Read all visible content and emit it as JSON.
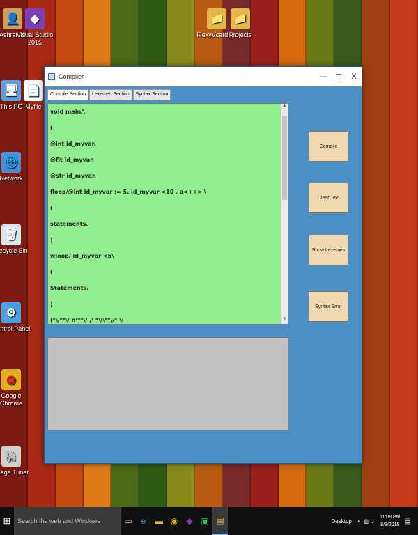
{
  "desktop": {
    "icons": [
      {
        "label": "Ashraf Ali",
        "glyph": "👤",
        "color": "#c8a060"
      },
      {
        "label": "Visual Studio 2015",
        "glyph": "◆",
        "color": "#7b3fb0"
      },
      {
        "label": "FlexyVcard_...",
        "glyph": "📁",
        "color": "#e3b84a"
      },
      {
        "label": "Projects",
        "glyph": "📁",
        "color": "#e3b84a"
      },
      {
        "label": "This PC",
        "glyph": "🖥",
        "color": "#5aa0e0"
      },
      {
        "label": "Myfile",
        "glyph": "📄",
        "color": "#ffffff"
      },
      {
        "label": "Network",
        "glyph": "🌐",
        "color": "#4a8fd8"
      },
      {
        "label": "Recycle Bin",
        "glyph": "🗑",
        "color": "#d8e8f0"
      },
      {
        "label": "Control Panel",
        "glyph": "⚙",
        "color": "#4aa0e0"
      },
      {
        "label": "Google Chrome",
        "glyph": "◉",
        "color": "#e0b020"
      },
      {
        "label": "Image Tuner",
        "glyph": "🐘",
        "color": "#d0d0d0"
      }
    ],
    "plank_colors": [
      "#7a1a10",
      "#a82a14",
      "#c64a14",
      "#e07a18",
      "#4a6a18",
      "#2f5a14",
      "#8a8a18",
      "#b85a10",
      "#7a2a2a",
      "#9a1f1a",
      "#d66a10",
      "#6a7a18",
      "#3a5a1a",
      "#a04010",
      "#c63a18"
    ]
  },
  "window": {
    "title": "Compiler",
    "minimize": "—",
    "maximize": "☐",
    "close": "X",
    "tabs": [
      "Compile Section",
      "Lexemes Section",
      "Syntax Section"
    ],
    "code_lines": [
      "void main/\\",
      "(",
      "@int id_myvar.",
      "@flt id_myvar.",
      "@str id_myvar.",
      "floop/@int id_myvar := 5. id_myvar <10 . a<++> \\",
      "(",
      " statements.",
      ")",
      "wloop/ id_myvar <5\\",
      "(",
      " Statements.",
      ")",
      "(*\\/**\\/ n\\**\\/ ,\\ *\\/\\**\\/* \\/"
    ],
    "buttons": {
      "compile": "Compile",
      "clear": "Clear Text",
      "lexemes": "Show Lexemes",
      "syntax": "Syntax Error"
    }
  },
  "taskbar": {
    "search_placeholder": "Search the web and Windows",
    "desktop_label": "Desktop",
    "time": "11:08 PM",
    "date": "8/8/2015"
  }
}
